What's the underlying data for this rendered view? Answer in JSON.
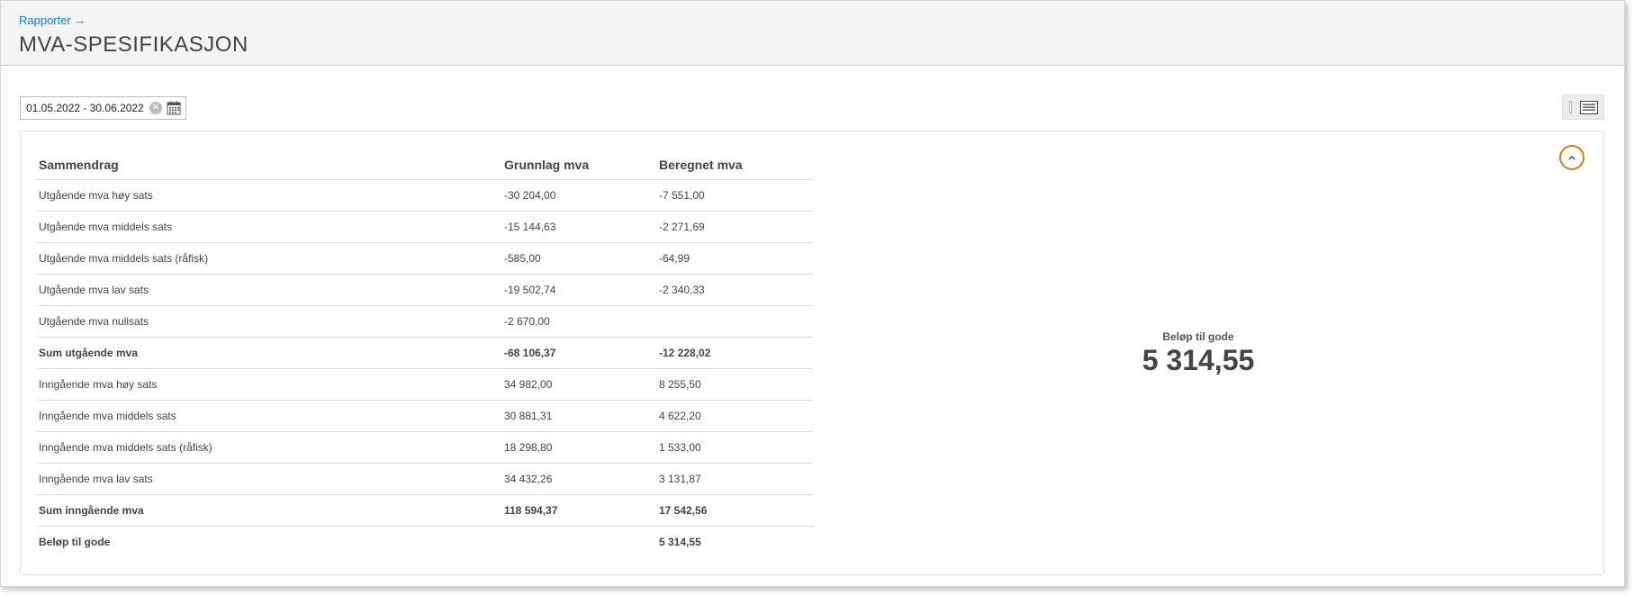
{
  "header": {
    "breadcrumb": "Rapporter →",
    "title": "MVA-SPESIFIKASJON"
  },
  "filter": {
    "date_range": "01.05.2022 - 30.06.2022"
  },
  "summary": {
    "columns": [
      "Sammendrag",
      "Grunnlag mva",
      "Beregnet mva"
    ],
    "rows": [
      {
        "label": "Utgående mva høy sats",
        "basis": "-30 204,00",
        "vat": "-7 551,00"
      },
      {
        "label": "Utgående mva middels sats",
        "basis": "-15 144,63",
        "vat": "-2 271,69"
      },
      {
        "label": "Utgående mva middels sats (råfisk)",
        "basis": "-585,00",
        "vat": "-64,99"
      },
      {
        "label": "Utgående mva lav sats",
        "basis": "-19 502,74",
        "vat": "-2 340,33"
      },
      {
        "label": "Utgående mva nullsats",
        "basis": "-2 670,00",
        "vat": ""
      },
      {
        "label": "Sum utgående mva",
        "basis": "-68 106,37",
        "vat": "-12 228,02"
      },
      {
        "label": "Inngående mva høy sats",
        "basis": "34 982,00",
        "vat": "8 255,50"
      },
      {
        "label": "Inngående mva middels sats",
        "basis": "30 881,31",
        "vat": "4 622,20"
      },
      {
        "label": "Inngående mva middels sats (råfisk)",
        "basis": "18 298,80",
        "vat": "1 533,00"
      },
      {
        "label": "Inngående mva lav sats",
        "basis": "34 432,26",
        "vat": "3 131,87"
      },
      {
        "label": "Sum inngående mva",
        "basis": "118 594,37",
        "vat": "17 542,56"
      },
      {
        "label": "Beløp til gode",
        "basis": "",
        "vat": "5 314,55"
      }
    ]
  },
  "total": {
    "label": "Beløp til gode",
    "value": "5 314,55"
  },
  "colors": {
    "link": "#1a7bbd",
    "accent": "#e07b1c",
    "header_bg": "#f4f4f4"
  },
  "icons": [
    "clear-icon",
    "calendar-icon",
    "list-view-icon",
    "chevron-up-icon"
  ]
}
